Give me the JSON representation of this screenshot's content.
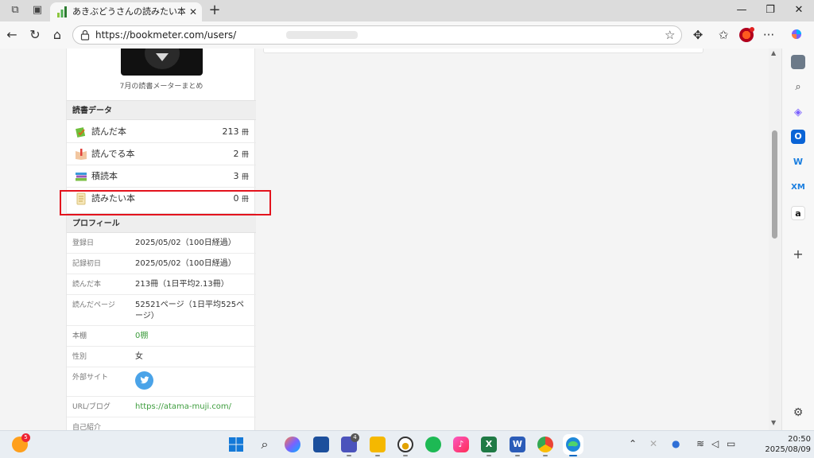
{
  "browser": {
    "tab_title": "あきぶどうさんの読みたい本 - 読書メ",
    "tab_close": "✕",
    "new_tab": "+",
    "url": "https://bookmeter.com/users/",
    "window": {
      "minimize": "—",
      "restore": "❐",
      "close": "✕"
    },
    "more": "···"
  },
  "profile_top": {
    "summary_link": "7月の読書メーターまとめ"
  },
  "reading_data": {
    "heading": "読書データ",
    "items": [
      {
        "label": "読んだ本",
        "count": "213",
        "unit": "冊"
      },
      {
        "label": "読んでる本",
        "count": "2",
        "unit": "冊"
      },
      {
        "label": "積読本",
        "count": "3",
        "unit": "冊"
      },
      {
        "label": "読みたい本",
        "count": "0",
        "unit": "冊"
      }
    ]
  },
  "profile": {
    "heading": "プロフィール",
    "rows": [
      {
        "key": "登録日",
        "value": "2025/05/02（100日経過）"
      },
      {
        "key": "記録初日",
        "value": "2025/05/02（100日経過）"
      },
      {
        "key": "読んだ本",
        "value": "213冊（1日平均2.13冊）"
      },
      {
        "key": "読んだページ",
        "value": "52521ページ（1日平均525ページ）"
      },
      {
        "key": "本棚",
        "value": "0棚"
      },
      {
        "key": "性別",
        "value": "女"
      },
      {
        "key": "外部サイト",
        "value": ""
      },
      {
        "key": "URL/ブログ",
        "value": "https://atama-muji.com/"
      },
      {
        "key": "自己紹介",
        "value": ""
      }
    ]
  },
  "edge_sidebar": {
    "items": [
      "search-icon",
      "copilot-icon",
      "outlook-icon",
      "wunderlist-icon",
      "xm-icon",
      "amazon-icon",
      "add-icon"
    ],
    "xm_label": "XM",
    "amazon_label": "a"
  },
  "taskbar": {
    "weather_badge": "5",
    "teams_badge": "4",
    "time": "20:50",
    "date": "2025/08/09"
  },
  "colors": {
    "accent_green": "#3e9d3e",
    "highlight_red": "#e3131d",
    "twitter_blue": "#4aa3e8"
  }
}
